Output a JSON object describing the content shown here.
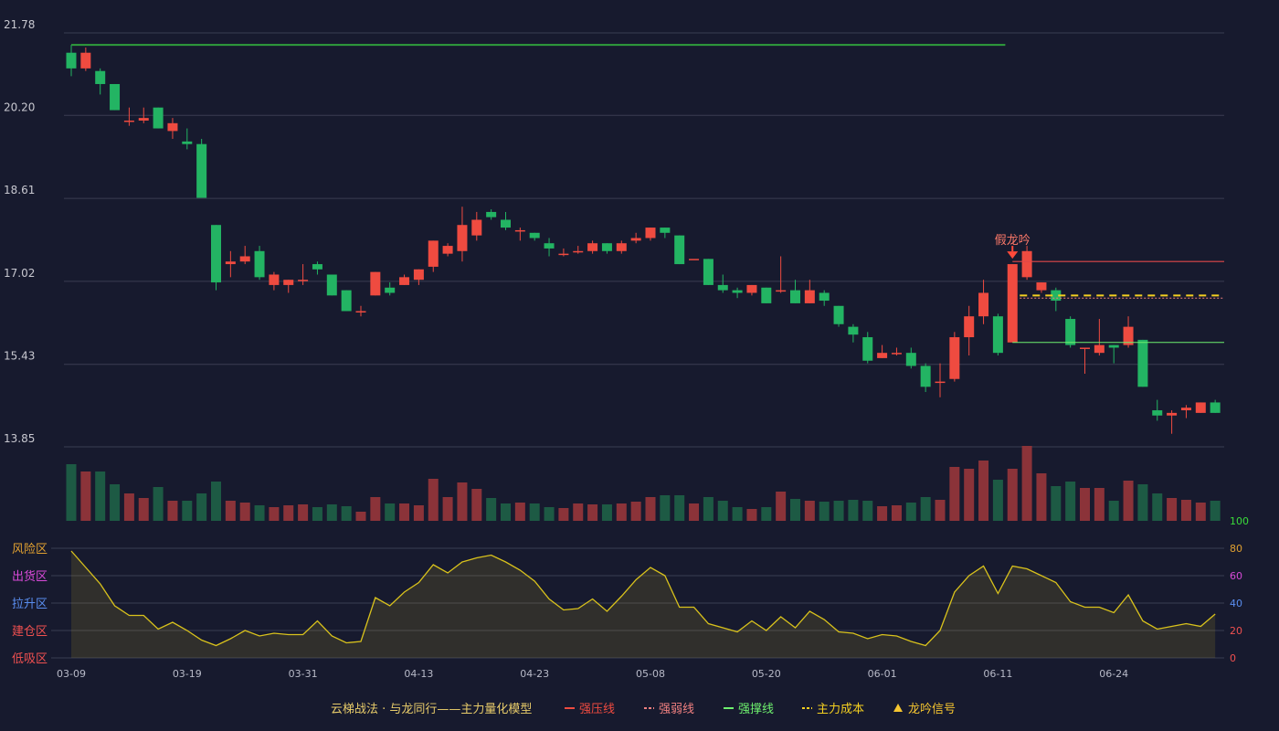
{
  "chart_data": {
    "type": "candlestick",
    "price_axis": {
      "ticks": [
        21.78,
        20.2,
        18.61,
        17.02,
        15.43,
        13.85
      ],
      "ylim": [
        13.85,
        21.78
      ]
    },
    "x_labels": [
      "03-09",
      "03-19",
      "03-31",
      "04-13",
      "04-23",
      "05-08",
      "05-20",
      "06-01",
      "06-11",
      "06-24"
    ],
    "x_label_index": [
      0,
      8,
      16,
      24,
      32,
      40,
      48,
      56,
      64,
      72
    ],
    "candles": [
      [
        21.4,
        21.1,
        21.55,
        20.95
      ],
      [
        21.1,
        21.4,
        21.5,
        21.05
      ],
      [
        21.05,
        20.8,
        21.1,
        20.6
      ],
      [
        20.8,
        20.3,
        20.8,
        20.3
      ],
      [
        20.1,
        20.1,
        20.35,
        20.0
      ],
      [
        20.1,
        20.15,
        20.35,
        20.05
      ],
      [
        20.35,
        19.95,
        20.35,
        19.95
      ],
      [
        19.9,
        20.05,
        20.15,
        19.75
      ],
      [
        19.7,
        19.65,
        19.95,
        19.55
      ],
      [
        19.65,
        18.62,
        19.75,
        18.62
      ],
      [
        18.1,
        17.0,
        18.1,
        16.85
      ],
      [
        17.35,
        17.4,
        17.6,
        17.1
      ],
      [
        17.4,
        17.5,
        17.7,
        17.35
      ],
      [
        17.6,
        17.1,
        17.7,
        17.05
      ],
      [
        16.95,
        17.15,
        17.2,
        16.85
      ],
      [
        16.95,
        17.05,
        17.05,
        16.8
      ],
      [
        17.05,
        17.05,
        17.35,
        16.95
      ],
      [
        17.35,
        17.25,
        17.4,
        17.15
      ],
      [
        17.15,
        16.75,
        17.15,
        16.75
      ],
      [
        16.85,
        16.45,
        16.85,
        16.45
      ],
      [
        16.45,
        16.45,
        16.55,
        16.35
      ],
      [
        16.75,
        17.2,
        17.2,
        16.75
      ],
      [
        16.9,
        16.8,
        17.0,
        16.75
      ],
      [
        16.95,
        17.1,
        17.15,
        16.95
      ],
      [
        17.05,
        17.25,
        17.25,
        16.95
      ],
      [
        17.3,
        17.8,
        17.8,
        17.2
      ],
      [
        17.55,
        17.7,
        17.75,
        17.5
      ],
      [
        17.6,
        18.1,
        18.45,
        17.4
      ],
      [
        17.9,
        18.2,
        18.35,
        17.8
      ],
      [
        18.35,
        18.25,
        18.4,
        18.2
      ],
      [
        18.2,
        18.05,
        18.35,
        18.0
      ],
      [
        18.0,
        18.0,
        18.05,
        17.8
      ],
      [
        17.95,
        17.85,
        17.95,
        17.8
      ],
      [
        17.75,
        17.65,
        17.85,
        17.5
      ],
      [
        17.55,
        17.55,
        17.65,
        17.5
      ],
      [
        17.6,
        17.6,
        17.7,
        17.55
      ],
      [
        17.6,
        17.75,
        17.8,
        17.55
      ],
      [
        17.75,
        17.6,
        17.75,
        17.55
      ],
      [
        17.6,
        17.75,
        17.8,
        17.55
      ],
      [
        17.8,
        17.85,
        17.95,
        17.75
      ],
      [
        17.85,
        18.05,
        18.05,
        17.8
      ],
      [
        18.05,
        17.95,
        18.05,
        17.85
      ],
      [
        17.9,
        17.35,
        17.9,
        17.35
      ],
      [
        17.45,
        17.45,
        17.45,
        17.45
      ],
      [
        17.45,
        16.95,
        17.45,
        16.95
      ],
      [
        16.95,
        16.85,
        17.15,
        16.8
      ],
      [
        16.85,
        16.8,
        16.9,
        16.7
      ],
      [
        16.8,
        16.95,
        16.95,
        16.75
      ],
      [
        16.9,
        16.6,
        16.9,
        16.6
      ],
      [
        16.85,
        16.85,
        17.5,
        16.8
      ],
      [
        16.85,
        16.6,
        17.05,
        16.6
      ],
      [
        16.6,
        16.85,
        17.05,
        16.6
      ],
      [
        16.8,
        16.65,
        16.85,
        16.55
      ],
      [
        16.55,
        16.2,
        16.55,
        16.15
      ],
      [
        16.15,
        16.0,
        16.2,
        15.85
      ],
      [
        15.95,
        15.5,
        16.05,
        15.45
      ],
      [
        15.55,
        15.65,
        15.8,
        15.55
      ],
      [
        15.65,
        15.65,
        15.75,
        15.6
      ],
      [
        15.65,
        15.4,
        15.75,
        15.35
      ],
      [
        15.4,
        15.0,
        15.45,
        14.9
      ],
      [
        15.1,
        15.1,
        15.45,
        14.8
      ],
      [
        15.15,
        15.95,
        16.05,
        15.1
      ],
      [
        15.95,
        16.35,
        16.55,
        15.6
      ],
      [
        16.35,
        16.8,
        17.05,
        16.2
      ],
      [
        16.35,
        15.65,
        16.4,
        15.6
      ],
      [
        15.85,
        17.35,
        17.35,
        15.85
      ],
      [
        17.1,
        17.6,
        17.7,
        17.05
      ],
      [
        16.85,
        17.0,
        17.0,
        16.8
      ],
      [
        16.85,
        16.65,
        16.9,
        16.45
      ],
      [
        16.3,
        15.8,
        16.35,
        15.75
      ],
      [
        15.75,
        15.75,
        15.75,
        15.25
      ],
      [
        15.65,
        15.8,
        16.3,
        15.6
      ],
      [
        15.8,
        15.75,
        15.8,
        15.45
      ],
      [
        15.8,
        16.15,
        16.35,
        15.75
      ],
      [
        15.9,
        15.0,
        15.9,
        15.0
      ],
      [
        14.55,
        14.45,
        14.75,
        14.35
      ],
      [
        14.45,
        14.5,
        14.55,
        14.1
      ],
      [
        14.55,
        14.6,
        14.65,
        14.4
      ],
      [
        14.5,
        14.7,
        14.7,
        14.5
      ],
      [
        14.7,
        14.5,
        14.75,
        14.5
      ]
    ],
    "volumes": [
      62,
      54,
      54,
      40,
      30,
      25,
      37,
      22,
      22,
      30,
      43,
      22,
      20,
      17,
      15,
      17,
      18,
      15,
      18,
      16,
      10,
      26,
      19,
      19,
      17,
      46,
      26,
      42,
      35,
      25,
      19,
      20,
      19,
      15,
      14,
      19,
      18,
      18,
      19,
      21,
      26,
      28,
      28,
      19,
      26,
      22,
      15,
      13,
      15,
      32,
      24,
      22,
      21,
      22,
      23,
      22,
      16,
      17,
      20,
      26,
      23,
      59,
      57,
      66,
      45,
      57,
      82,
      52,
      38,
      43,
      36,
      36,
      22,
      44,
      40,
      30,
      25,
      23,
      20,
      22
    ],
    "indicator": {
      "zones": [
        "风险区",
        "出货区",
        "拉升区",
        "建仓区",
        "低吸区"
      ],
      "zone_colors": [
        "#e0a030",
        "#d84ad8",
        "#5a8ef0",
        "#f05050",
        "#f05050"
      ],
      "right_ticks": [
        "100",
        "80",
        "60",
        "40",
        "20",
        "0"
      ],
      "right_tick_colors": [
        "#3adc3a",
        "#e0a030",
        "#d84ad8",
        "#5a8ef0",
        "#f05050",
        "#f05050"
      ],
      "ylim": [
        0,
        100
      ],
      "values": [
        78,
        66,
        54,
        38,
        31,
        31,
        21,
        26,
        20,
        13,
        9,
        14,
        20,
        16,
        18,
        17,
        17,
        27,
        16,
        11,
        12,
        44,
        38,
        48,
        55,
        68,
        62,
        70,
        73,
        75,
        70,
        64,
        56,
        43,
        35,
        36,
        43,
        34,
        45,
        57,
        66,
        60,
        37,
        37,
        25,
        22,
        19,
        27,
        20,
        30,
        22,
        34,
        28,
        19,
        18,
        14,
        17,
        16,
        12,
        9,
        20,
        48,
        60,
        67,
        47,
        67,
        65,
        60,
        55,
        41,
        37,
        37,
        33,
        46,
        27,
        21,
        23,
        25,
        23,
        32
      ]
    },
    "annotations": {
      "signal_label": "假龙吟",
      "signal_index": 65,
      "strong_pressure": {
        "price": 17.4,
        "from_index": 65
      },
      "weak_line": {
        "price": 16.7,
        "from_index": 65
      },
      "support_line": {
        "price": 15.85,
        "from_index": 65
      },
      "main_cost": {
        "price": 16.75,
        "from_index": 65
      },
      "top_line": {
        "price": 21.55,
        "to_index": 64
      }
    },
    "colors": {
      "up": "#ef4b40",
      "down": "#23b463",
      "vol_up": "#8b3339",
      "vol_down": "#1d5a44",
      "indicator_line": "#d9c21c"
    }
  },
  "legend": {
    "title": "云梯战法 · 与龙同行——主力量化模型",
    "items": [
      {
        "label": "强压线",
        "color": "#ef4b40",
        "style": "solid"
      },
      {
        "label": "强弱线",
        "color": "#f08080",
        "style": "dashed"
      },
      {
        "label": "强撑线",
        "color": "#6ef06e",
        "style": "solid"
      },
      {
        "label": "主力成本",
        "color": "#f5d020",
        "style": "dashed"
      },
      {
        "label": "龙吟信号",
        "color": "#f5c530",
        "style": "triangle"
      }
    ]
  }
}
